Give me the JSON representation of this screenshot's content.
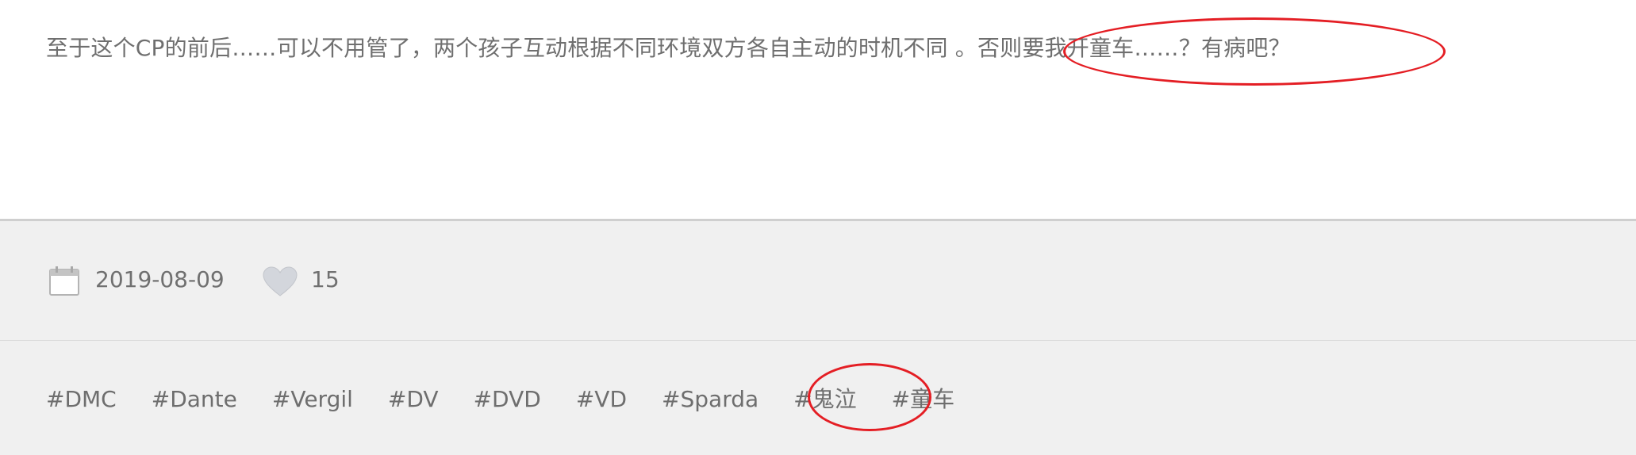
{
  "post": {
    "text": "至于这个CP的前后……可以不用管了，两个孩子互动根据不同环境双方各自主动的时机不同 。否则要我开童车……？有病吧？"
  },
  "meta": {
    "date": "2019-08-09",
    "likes": "15",
    "icons": [
      "calendar-icon",
      "heart-icon"
    ]
  },
  "tags": [
    "#DMC",
    "#Dante",
    "#Vergil",
    "#DV",
    "#DVD",
    "#VD",
    "#Sparda",
    "#鬼泣",
    "#童车"
  ],
  "colors": {
    "text": "#6f6f6f",
    "footer_bg": "#f0f0f0",
    "annotation": "#e41e24"
  }
}
